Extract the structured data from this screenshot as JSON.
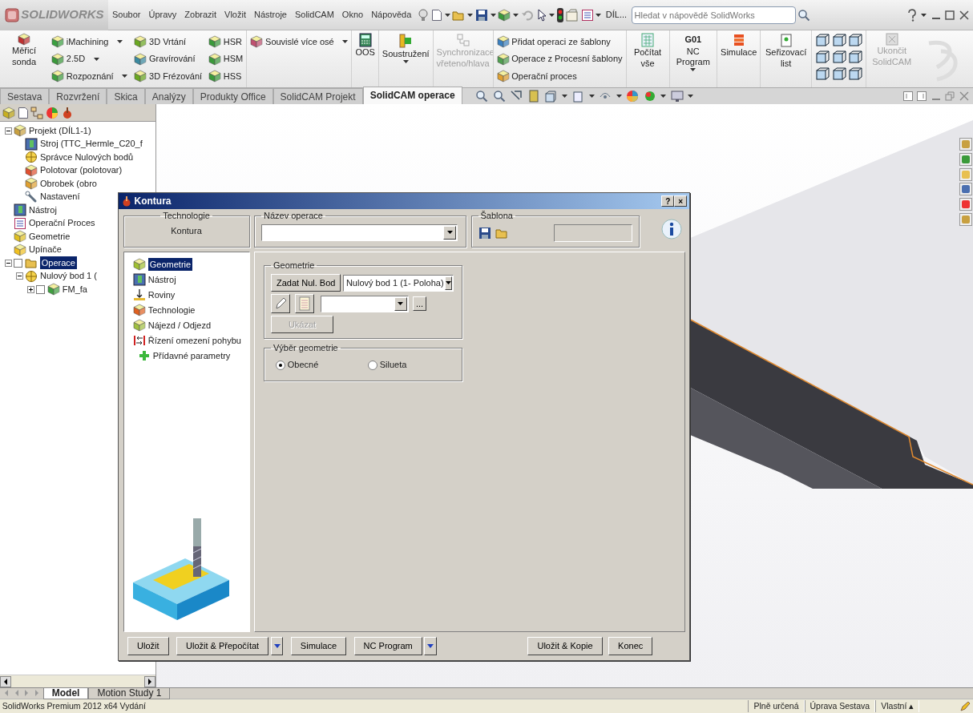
{
  "app": {
    "logo": "SOLIDWORKS",
    "menu": [
      "Soubor",
      "Úpravy",
      "Zobrazit",
      "Vložit",
      "Nástroje",
      "SolidCAM",
      "Okno",
      "Nápověda"
    ],
    "document": "DÍL...",
    "search": {
      "placeholder": "Hledat v nápovědě SolidWorks"
    }
  },
  "ribbon": [
    {
      "kind": "large",
      "label": "Měřicí sonda",
      "disabled": false,
      "dropdown": false
    },
    {
      "kind": "stack",
      "items": [
        {
          "label": "iMachining",
          "dropdown": true
        },
        {
          "label": "2.5D",
          "dropdown": true
        },
        {
          "label": "Rozpoznání",
          "dropdown": true
        }
      ]
    },
    {
      "kind": "stack",
      "items": [
        {
          "label": "3D Vrtání",
          "dropdown": false
        },
        {
          "label": "Gravírování",
          "dropdown": false
        },
        {
          "label": "3D Frézování",
          "dropdown": false
        }
      ]
    },
    {
      "kind": "stack",
      "items": [
        {
          "label": "HSR",
          "dropdown": false
        },
        {
          "label": "HSM",
          "dropdown": false
        },
        {
          "label": "HSS",
          "dropdown": false
        }
      ]
    },
    {
      "kind": "stack",
      "items": [
        {
          "label": "Souvislé více osé",
          "dropdown": true
        }
      ]
    },
    {
      "kind": "large",
      "label": "OOS",
      "disabled": false,
      "dropdown": false
    },
    {
      "kind": "large",
      "label": "Soustružení",
      "disabled": false,
      "dropdown": true
    },
    {
      "kind": "large",
      "label": "Synchronizace vřeteno/hlava",
      "disabled": true,
      "dropdown": false
    },
    {
      "kind": "stack",
      "items": [
        {
          "label": "Přidat operaci ze šablony",
          "dropdown": false
        },
        {
          "label": "Operace z Procesní šablony",
          "dropdown": false
        },
        {
          "label": "Operační proces",
          "dropdown": false
        }
      ]
    },
    {
      "kind": "large",
      "label": "Počítat vše",
      "disabled": false,
      "dropdown": false
    },
    {
      "kind": "large",
      "caption": "G01",
      "label": "NC Program",
      "disabled": false,
      "dropdown": true
    },
    {
      "kind": "large",
      "label": "Simulace",
      "disabled": false,
      "dropdown": false
    },
    {
      "kind": "large",
      "label": "Seřizovací list",
      "disabled": false,
      "dropdown": false
    },
    {
      "kind": "grid"
    },
    {
      "kind": "large",
      "label": "Ukončit SolidCAM",
      "disabled": true,
      "dropdown": false
    }
  ],
  "command_tabs": [
    {
      "label": "Sestava",
      "selected": false
    },
    {
      "label": "Rozvržení",
      "selected": false
    },
    {
      "label": "Skica",
      "selected": false
    },
    {
      "label": "Analýzy",
      "selected": false
    },
    {
      "label": "Produkty Office",
      "selected": false
    },
    {
      "label": "SolidCAM Projekt",
      "selected": false
    },
    {
      "label": "SolidCAM operace",
      "selected": true
    }
  ],
  "feature_tree": [
    {
      "label": "Projekt (DÍL1-1)",
      "selected": false,
      "expanded": true,
      "children": [
        {
          "label": "Stroj (TTC_Hermle_C20_f",
          "selected": false
        },
        {
          "label": "Správce Nulových bodů",
          "selected": false
        },
        {
          "label": "Polotovar (polotovar)",
          "selected": false
        },
        {
          "label": "Obrobek (obro",
          "selected": false
        },
        {
          "label": "Nastavení",
          "selected": false
        }
      ]
    },
    {
      "label": "Nástroj",
      "selected": false
    },
    {
      "label": "Operační Proces",
      "selected": false
    },
    {
      "label": "Geometrie",
      "selected": false
    },
    {
      "label": "Upínače",
      "selected": false
    },
    {
      "label": "Operace",
      "selected": true,
      "checked": false,
      "expanded": true,
      "children": [
        {
          "label": "Nulový bod 1 (",
          "selected": false,
          "expanded": true,
          "children": [
            {
              "label": "FM_fa",
              "selected": false,
              "checked": false,
              "expanded": false
            }
          ]
        }
      ]
    }
  ],
  "dialog": {
    "title": "Kontura",
    "help_button": "?",
    "close_button": "×",
    "technology": {
      "legend": "Technologie",
      "value": "Kontura"
    },
    "operation_name": {
      "legend": "Název operace"
    },
    "template": {
      "legend": "Šablona"
    },
    "nav": [
      {
        "label": "Geometrie",
        "selected": true
      },
      {
        "label": "Nástroj",
        "selected": false
      },
      {
        "label": "Roviny",
        "selected": false
      },
      {
        "label": "Technologie",
        "selected": false
      },
      {
        "label": "Nájezd / Odjezd",
        "selected": false
      },
      {
        "label": "Řízení omezení pohybu",
        "selected": false
      },
      {
        "label": "Přídavné parametry",
        "selected": false
      }
    ],
    "geometry": {
      "legend": "Geometrie",
      "set_button": "Zadat Nul. Bod",
      "zero_point": "Nulový bod 1 (1- Poloha)",
      "browse_button": "...",
      "show_button": {
        "label": "Ukázat",
        "disabled": true
      }
    },
    "selection": {
      "legend": "Výběr geometrie",
      "options": [
        {
          "label": "Obecné",
          "selected": true
        },
        {
          "label": "Silueta",
          "selected": false
        }
      ]
    },
    "buttons": [
      {
        "label": "Uložit"
      },
      {
        "label": "Uložit & Přepočítat",
        "dropdown": true
      },
      {
        "label": "Simulace"
      },
      {
        "label": "NC Program",
        "dropdown": true
      },
      {
        "label": "Uložit & Kopie"
      },
      {
        "label": "Konec"
      }
    ]
  },
  "bottom_tabs": [
    {
      "label": "Model",
      "selected": true
    },
    {
      "label": "Motion Study 1",
      "selected": false
    }
  ],
  "status_bar": {
    "text": "SolidWorks Premium 2012 x64 Vydání",
    "panels": [
      "Plně určená",
      "Úprava Sestava",
      "Vlastní ▴"
    ]
  }
}
